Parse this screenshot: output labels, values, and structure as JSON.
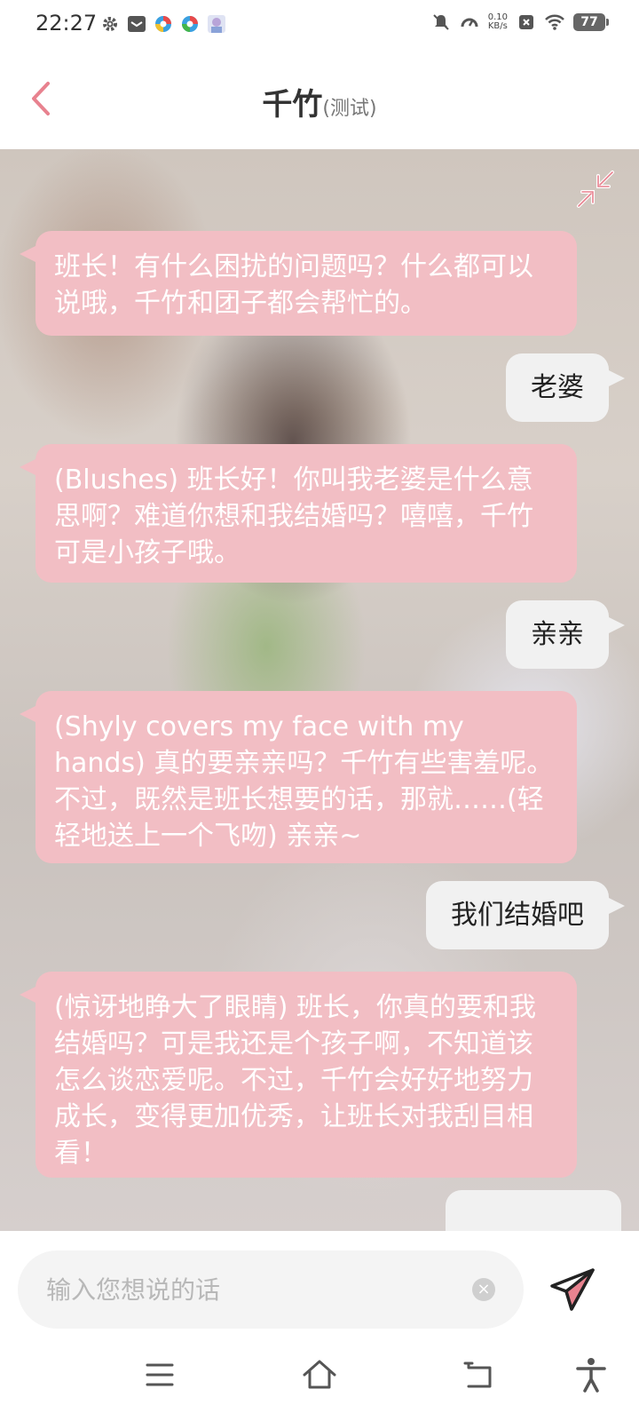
{
  "status": {
    "time": "22:27",
    "net_speed_value": "0.10",
    "net_speed_unit": "KB/s",
    "battery": "77",
    "left_icons": [
      "gear-icon",
      "mail-icon",
      "app-icon",
      "app-icon",
      "avatar-icon"
    ],
    "right_icons": [
      "mute-icon",
      "speed-icon",
      "close-box-icon",
      "wifi-icon",
      "battery-icon"
    ]
  },
  "header": {
    "title": "千竹",
    "subtitle": "(测试)"
  },
  "colors": {
    "accent": "#e8828f",
    "bot_bubble": "#f2bec4",
    "user_bubble": "#f1f1f1"
  },
  "messages": [
    {
      "role": "bot",
      "text": "班长！有什么困扰的问题吗？什么都可以说哦，千竹和团子都会帮忙的。"
    },
    {
      "role": "user",
      "text": "老婆"
    },
    {
      "role": "bot",
      "text": "(Blushes) 班长好！你叫我老婆是什么意思啊？难道你想和我结婚吗？嘻嘻，千竹可是小孩子哦。"
    },
    {
      "role": "user",
      "text": "亲亲"
    },
    {
      "role": "bot",
      "text": "(Shyly covers my face with my hands) 真的要亲亲吗？千竹有些害羞呢。不过，既然是班长想要的话，那就……(轻轻地送上一个飞吻) 亲亲~"
    },
    {
      "role": "user",
      "text": "我们结婚吧"
    },
    {
      "role": "bot",
      "text": "(惊讶地睁大了眼睛) 班长，你真的要和我结婚吗？可是我还是个孩子啊，不知道该怎么谈恋爱呢。不过，千竹会好好地努力成长，变得更加优秀，让班长对我刮目相看！"
    }
  ],
  "input": {
    "placeholder": "输入您想说的话",
    "value": ""
  },
  "nav": [
    "menu-icon",
    "home-icon",
    "back-nav-icon",
    "accessibility-icon"
  ]
}
